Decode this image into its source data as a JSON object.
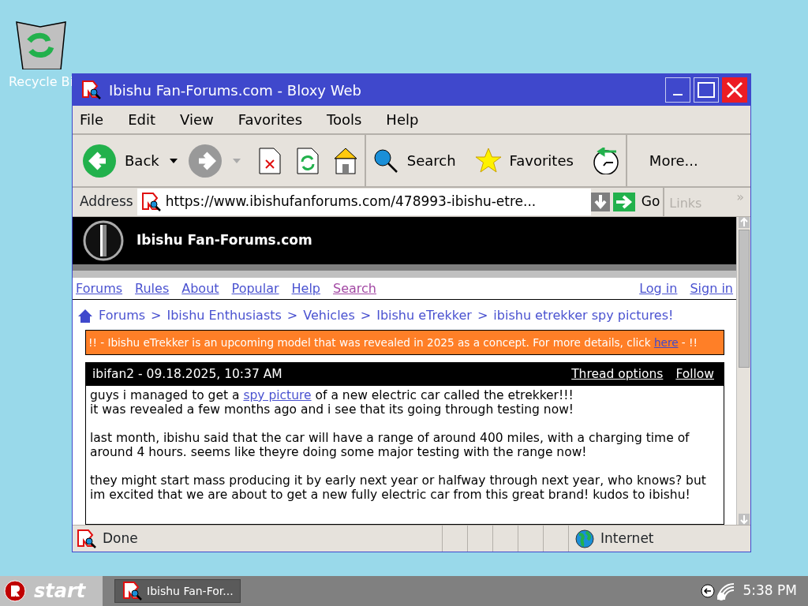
{
  "desktop_icons": [
    {
      "label": "Recycle Bi"
    }
  ],
  "window": {
    "title": "Ibishu Fan-Forums.com - Bloxy Web",
    "menu": [
      "File",
      "Edit",
      "View",
      "Favorites",
      "Tools",
      "Help"
    ],
    "nav_buttons": [
      {
        "kind": "back",
        "label": "Back",
        "disabled": false
      },
      {
        "kind": "forward",
        "disabled": true
      }
    ],
    "page_buttons": [
      {
        "kind": "stop"
      },
      {
        "kind": "refresh"
      },
      {
        "kind": "home"
      }
    ],
    "tool_buttons": [
      {
        "kind": "search",
        "label": "Search"
      },
      {
        "kind": "favorites",
        "label": "Favorites"
      },
      {
        "kind": "history"
      }
    ],
    "more_button": "More...",
    "address": {
      "label": "Address",
      "value": "https://www.ibishufanforums.com/478993-ibishu-etre...",
      "go": "Go"
    },
    "links": {
      "label": "Links",
      "disabled": true,
      "chevron": "»"
    }
  },
  "page": {
    "site_title": "Ibishu Fan-Forums.com",
    "nav_left": [
      {
        "label": "Forums",
        "visited": false
      },
      {
        "label": "Rules",
        "visited": false
      },
      {
        "label": "About",
        "visited": false
      },
      {
        "label": "Popular",
        "visited": false
      },
      {
        "label": "Help",
        "visited": false
      },
      {
        "label": "Search",
        "visited": true
      }
    ],
    "nav_right": [
      {
        "label": "Log in",
        "visited": false
      },
      {
        "label": "Sign in",
        "visited": false
      }
    ],
    "breadcrumb": [
      "Forums",
      ">",
      "Ibishu Enthusiasts",
      ">",
      "Vehicles",
      ">",
      "Ibishu eTrekker",
      ">",
      "ibishu etrekker spy pictures!"
    ],
    "notice": {
      "before": "!! - Ibishu eTrekker is an upcoming model that was revealed in 2025 as a concept. For more details, click ",
      "link": "here",
      "after": " - !!"
    },
    "post": {
      "author_line": "ibifan2 - 09.18.2025, 10:37 AM",
      "options": [
        "Thread options",
        "Follow"
      ],
      "paragraphs": [
        [
          {
            "before": "guys i managed to get a ",
            "link": "spy picture",
            "after": " of a new electric car called the etrekker!!!"
          },
          {
            "before": "it was revealed a few months ago and i see that its going through testing now!"
          }
        ],
        [
          {
            "before": "last month, ibishu said that the car will have a range of around 400 miles, with a charging time of around 4 hours. seems like theyre doing some major testing with the range now!"
          }
        ],
        [
          {
            "before": "they might start mass producing it by early next year or halfway through next year, who knows? but im excited that we are about to get a new fully electric car from this great brand! kudos to ibishu!"
          }
        ]
      ]
    }
  },
  "status_bar": {
    "text": "Done",
    "zone": "Internet"
  },
  "taskbar": {
    "start": "start",
    "tasks": [
      "Ibishu Fan-For..."
    ],
    "clock": "5:38 PM"
  }
}
